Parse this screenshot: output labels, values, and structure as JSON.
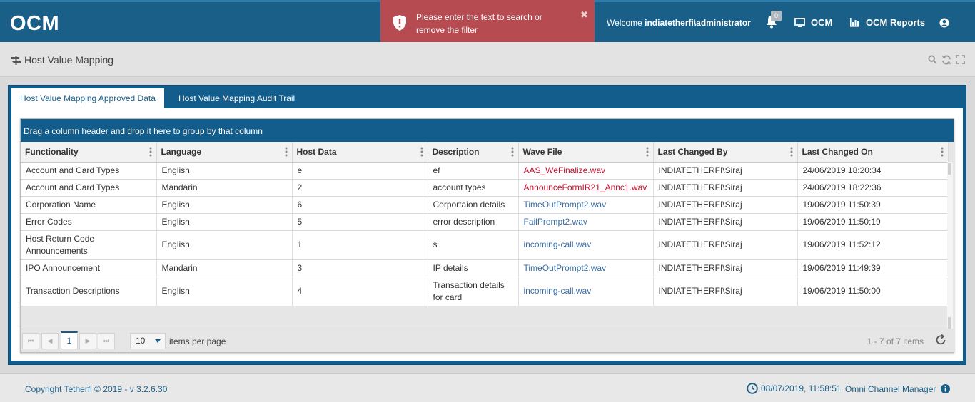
{
  "header": {
    "logo": "OCM",
    "welcome_prefix": "Welcome",
    "username": "indiatetherfi\\administrator",
    "notification_count": "0",
    "nav_ocm": "OCM",
    "nav_reports": "OCM Reports"
  },
  "toast": {
    "message": "Please enter the text to search or remove the filter",
    "close_glyph": "✖"
  },
  "page": {
    "title": "Host Value Mapping"
  },
  "tabs": [
    {
      "label": "Host Value Mapping Approved Data",
      "active": true
    },
    {
      "label": "Host Value Mapping Audit Trail",
      "active": false
    }
  ],
  "grid": {
    "group_hint": "Drag a column header and drop it here to group by that column",
    "columns": [
      "Functionality",
      "Language",
      "Host Data",
      "Description",
      "Wave File",
      "Last Changed By",
      "Last Changed On"
    ],
    "rows": [
      [
        "Account and Card Types",
        "English",
        "e",
        "ef",
        "AAS_WeFinalize.wav",
        "INDIATETHERFI\\Siraj",
        "24/06/2019 18:20:34"
      ],
      [
        "Account and Card Types",
        "Mandarin",
        "2",
        "account types",
        "AnnounceFormIR21_Annc1.wav",
        "INDIATETHERFI\\Siraj",
        "24/06/2019 18:22:36"
      ],
      [
        "Corporation Name",
        "English",
        "6",
        "Corportaion details",
        "TimeOutPrompt2.wav",
        "INDIATETHERFI\\Siraj",
        "19/06/2019 11:50:39"
      ],
      [
        "Error Codes",
        "English",
        "5",
        "error description",
        "FailPrompt2.wav",
        "INDIATETHERFI\\Siraj",
        "19/06/2019 11:50:19"
      ],
      [
        "Host Return Code Announcements",
        "English",
        "1",
        "s",
        "incoming-call.wav",
        "INDIATETHERFI\\Siraj",
        "19/06/2019 11:52:12"
      ],
      [
        "IPO Announcement",
        "Mandarin",
        "3",
        "IP details",
        "TimeOutPrompt2.wav",
        "INDIATETHERFI\\Siraj",
        "19/06/2019 11:49:39"
      ],
      [
        "Transaction Descriptions",
        "English",
        "4",
        "Transaction details for card",
        "incoming-call.wav",
        "INDIATETHERFI\\Siraj",
        "19/06/2019 11:50:00"
      ]
    ],
    "wave_colors": [
      "#c8102e",
      "#c8102e",
      "#3a6ea5",
      "#3a6ea5",
      "#3a6ea5",
      "#3a6ea5",
      "#3a6ea5"
    ]
  },
  "pager": {
    "current_page": "1",
    "page_size": "10",
    "items_per_page_label": "items per page",
    "info": "1 - 7 of 7 items"
  },
  "footer": {
    "copyright": "Copyright Tetherfi © 2019 - v 3.2.6.30",
    "datetime": "08/07/2019, 11:58:51",
    "app_name": "Omni Channel Manager"
  },
  "colors": {
    "header": "#1a5f88",
    "toast": "#b64b52",
    "panel": "#125d8b"
  }
}
